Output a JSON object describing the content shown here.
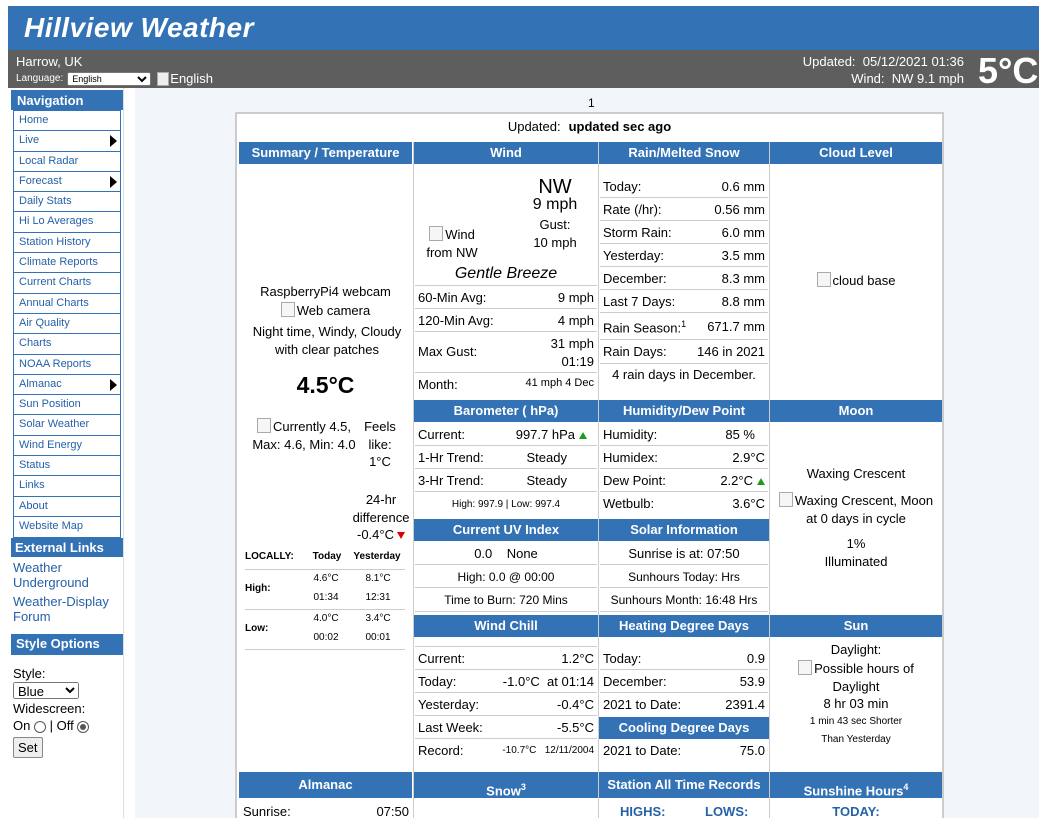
{
  "header": {
    "title": "Hillview Weather"
  },
  "info": {
    "location": "Harrow, UK",
    "language_label": "Language:",
    "language_value": "English",
    "language_flag_text": "English",
    "updated_label": "Updated:",
    "updated_value": "05/12/2021 01:36",
    "wind_label": "Wind:",
    "wind_value": "NW  9.1 mph",
    "big_temp": "5°C"
  },
  "sidebar": {
    "nav_title": "Navigation",
    "items": [
      {
        "label": "Home"
      },
      {
        "label": "Live"
      },
      {
        "label": "Local Radar"
      },
      {
        "label": "Forecast"
      },
      {
        "label": "Daily Stats"
      },
      {
        "label": "Hi Lo Averages"
      },
      {
        "label": "Station History"
      },
      {
        "label": "Climate Reports"
      },
      {
        "label": "Current Charts"
      },
      {
        "label": "Annual Charts"
      },
      {
        "label": "Air Quality"
      },
      {
        "label": "Charts"
      },
      {
        "label": "NOAA Reports"
      },
      {
        "label": "Almanac"
      },
      {
        "label": "Sun Position"
      },
      {
        "label": "Solar Weather"
      },
      {
        "label": "Wind Energy"
      },
      {
        "label": "Status"
      },
      {
        "label": "Links"
      },
      {
        "label": "About"
      },
      {
        "label": "Website Map"
      }
    ],
    "ext_title": "External Links",
    "ext_links": [
      "Weather Underground",
      "Weather-Display Forum"
    ],
    "style_title": "Style Options",
    "style_label": "Style:",
    "style_value": "Blue",
    "widescreen_label": "Widescreen:",
    "on_label": "On",
    "off_label": "| Off",
    "set_label": "Set"
  },
  "main": {
    "page_number": "1",
    "updated_label": "Updated:",
    "updated_value": "updated  sec ago",
    "summary": {
      "header": "Summary / Temperature",
      "webcam_title": "RaspberryPi4 webcam",
      "webcam_alt": "Web camera",
      "conditions": "Night time, Windy, Cloudy with clear patches",
      "temp": "4.5°C",
      "currently_text": "Currently 4.5, Max: 4.6, Min: 4.0",
      "feels_like": "Feels like:",
      "feels_value": "1°C",
      "diff_label": "24-hr difference",
      "diff_value": "-0.4°C",
      "table_locally": "LOCALLY:",
      "table_today": "Today",
      "table_yesterday": "Yesterday",
      "high_label": "High:",
      "high_today": "4.6°C",
      "high_today_time": "01:34",
      "high_yest": "8.1°C",
      "high_yest_time": "12:31",
      "low_label": "Low:",
      "low_today": "4.0°C",
      "low_today_time": "00:02",
      "low_yest": "3.4°C",
      "low_yest_time": "00:01"
    },
    "wind": {
      "header": "Wind",
      "img_alt": "Wind from NW",
      "direction": "NW",
      "speed": "9 mph",
      "gust_label": "Gust:",
      "gust_value": "10 mph",
      "beaufort": "Gentle Breeze",
      "avg60_label": "60-Min Avg:",
      "avg60_value": "9 mph",
      "avg120_label": "120-Min Avg:",
      "avg120_value": "4 mph",
      "maxgust_label": "Max Gust:",
      "maxgust_value": "31 mph",
      "maxgust_time": "01:19",
      "month_label": "Month:",
      "month_value": "41 mph 4 Dec"
    },
    "rain": {
      "header": "Rain/Melted Snow",
      "rows": [
        {
          "label": "Today:",
          "value": "0.6 mm"
        },
        {
          "label": "Rate (/hr):",
          "value": "0.56 mm"
        },
        {
          "label": "Storm Rain:",
          "value": "6.0 mm"
        },
        {
          "label": "Yesterday:",
          "value": "3.5 mm"
        },
        {
          "label": "December:",
          "value": "8.3 mm"
        },
        {
          "label": "Last 7 Days:",
          "value": "8.8 mm"
        }
      ],
      "season_label": "Rain Season:",
      "season_sup": "1",
      "season_value": "671.7 mm",
      "days_label": "Rain Days:",
      "days_value": "146 in 2021",
      "note": "4 rain days in December."
    },
    "cloud": {
      "header": "Cloud Level",
      "img_alt": "cloud base"
    },
    "barometer": {
      "header": "Barometer ( hPa)",
      "current_label": "Current:",
      "current_value": "997.7 hPa",
      "trend1_label": "1-Hr Trend:",
      "trend1_value": "Steady",
      "trend3_label": "3-Hr Trend:",
      "trend3_value": "Steady",
      "hilo": "High: 997.9  | Low:  997.4"
    },
    "humidity": {
      "header": "Humidity/Dew Point",
      "hum_label": "Humidity:",
      "hum_value": "85 %",
      "humidex_label": "Humidex:",
      "humidex_value": "2.9°C",
      "dew_label": "Dew Point:",
      "dew_value": "2.2°C",
      "wetbulb_label": "Wetbulb:",
      "wetbulb_value": "3.6°C"
    },
    "moon": {
      "header": "Moon",
      "phase": "Waxing Crescent",
      "img_alt": "Waxing Crescent, Moon at 0 days in cycle",
      "illum_pct": "1%",
      "illum_label": "Illuminated"
    },
    "uv": {
      "header": "Current UV Index",
      "current": "0.0    None",
      "high": "High: 0.0 @ 00:00",
      "burn": "Time to Burn: 720 Mins"
    },
    "solar": {
      "header": "Solar Information",
      "sunrise": "Sunrise is at: 07:50",
      "sunhours_today": "Sunhours Today: Hrs",
      "sunhours_month": "Sunhours Month: 16:48 Hrs"
    },
    "windchill": {
      "header": "Wind Chill",
      "current_label": "Current:",
      "current_value": "1.2°C",
      "today_label": "Today:",
      "today_value": "-1.0°C  at 01:14",
      "yest_label": "Yesterday:",
      "yest_value": "-0.4°C",
      "week_label": "Last Week:",
      "week_value": "-5.5°C",
      "record_label": "Record:",
      "record_value": "-10.7°C   12/11/2004"
    },
    "hdd": {
      "header": "Heating Degree Days",
      "today_label": "Today:",
      "today_value": "0.9",
      "dec_label": "December:",
      "dec_value": "53.9",
      "ytd_label": "2021 to Date:",
      "ytd_value": "2391.4"
    },
    "cdd": {
      "header": "Cooling Degree Days",
      "ytd_label": "2021 to Date:",
      "ytd_value": "75.0"
    },
    "sun": {
      "header": "Sun",
      "daylight_label": "Daylight:",
      "img_alt": "Possible hours of Daylight",
      "daylight_value": "8 hr 03 min",
      "shorter": "1 min 43 sec Shorter",
      "than": "Than Yesterday"
    },
    "almanac": {
      "header": "Almanac",
      "sunrise_label": "Sunrise:",
      "sunrise_value": "07:50"
    },
    "snow": {
      "header": "Snow",
      "sup": "3"
    },
    "records": {
      "header": "Station All Time Records",
      "highs": "HIGHS:",
      "lows": "LOWS:"
    },
    "sunshine": {
      "header": "Sunshine Hours",
      "sup": "4",
      "today": "TODAY:"
    }
  }
}
